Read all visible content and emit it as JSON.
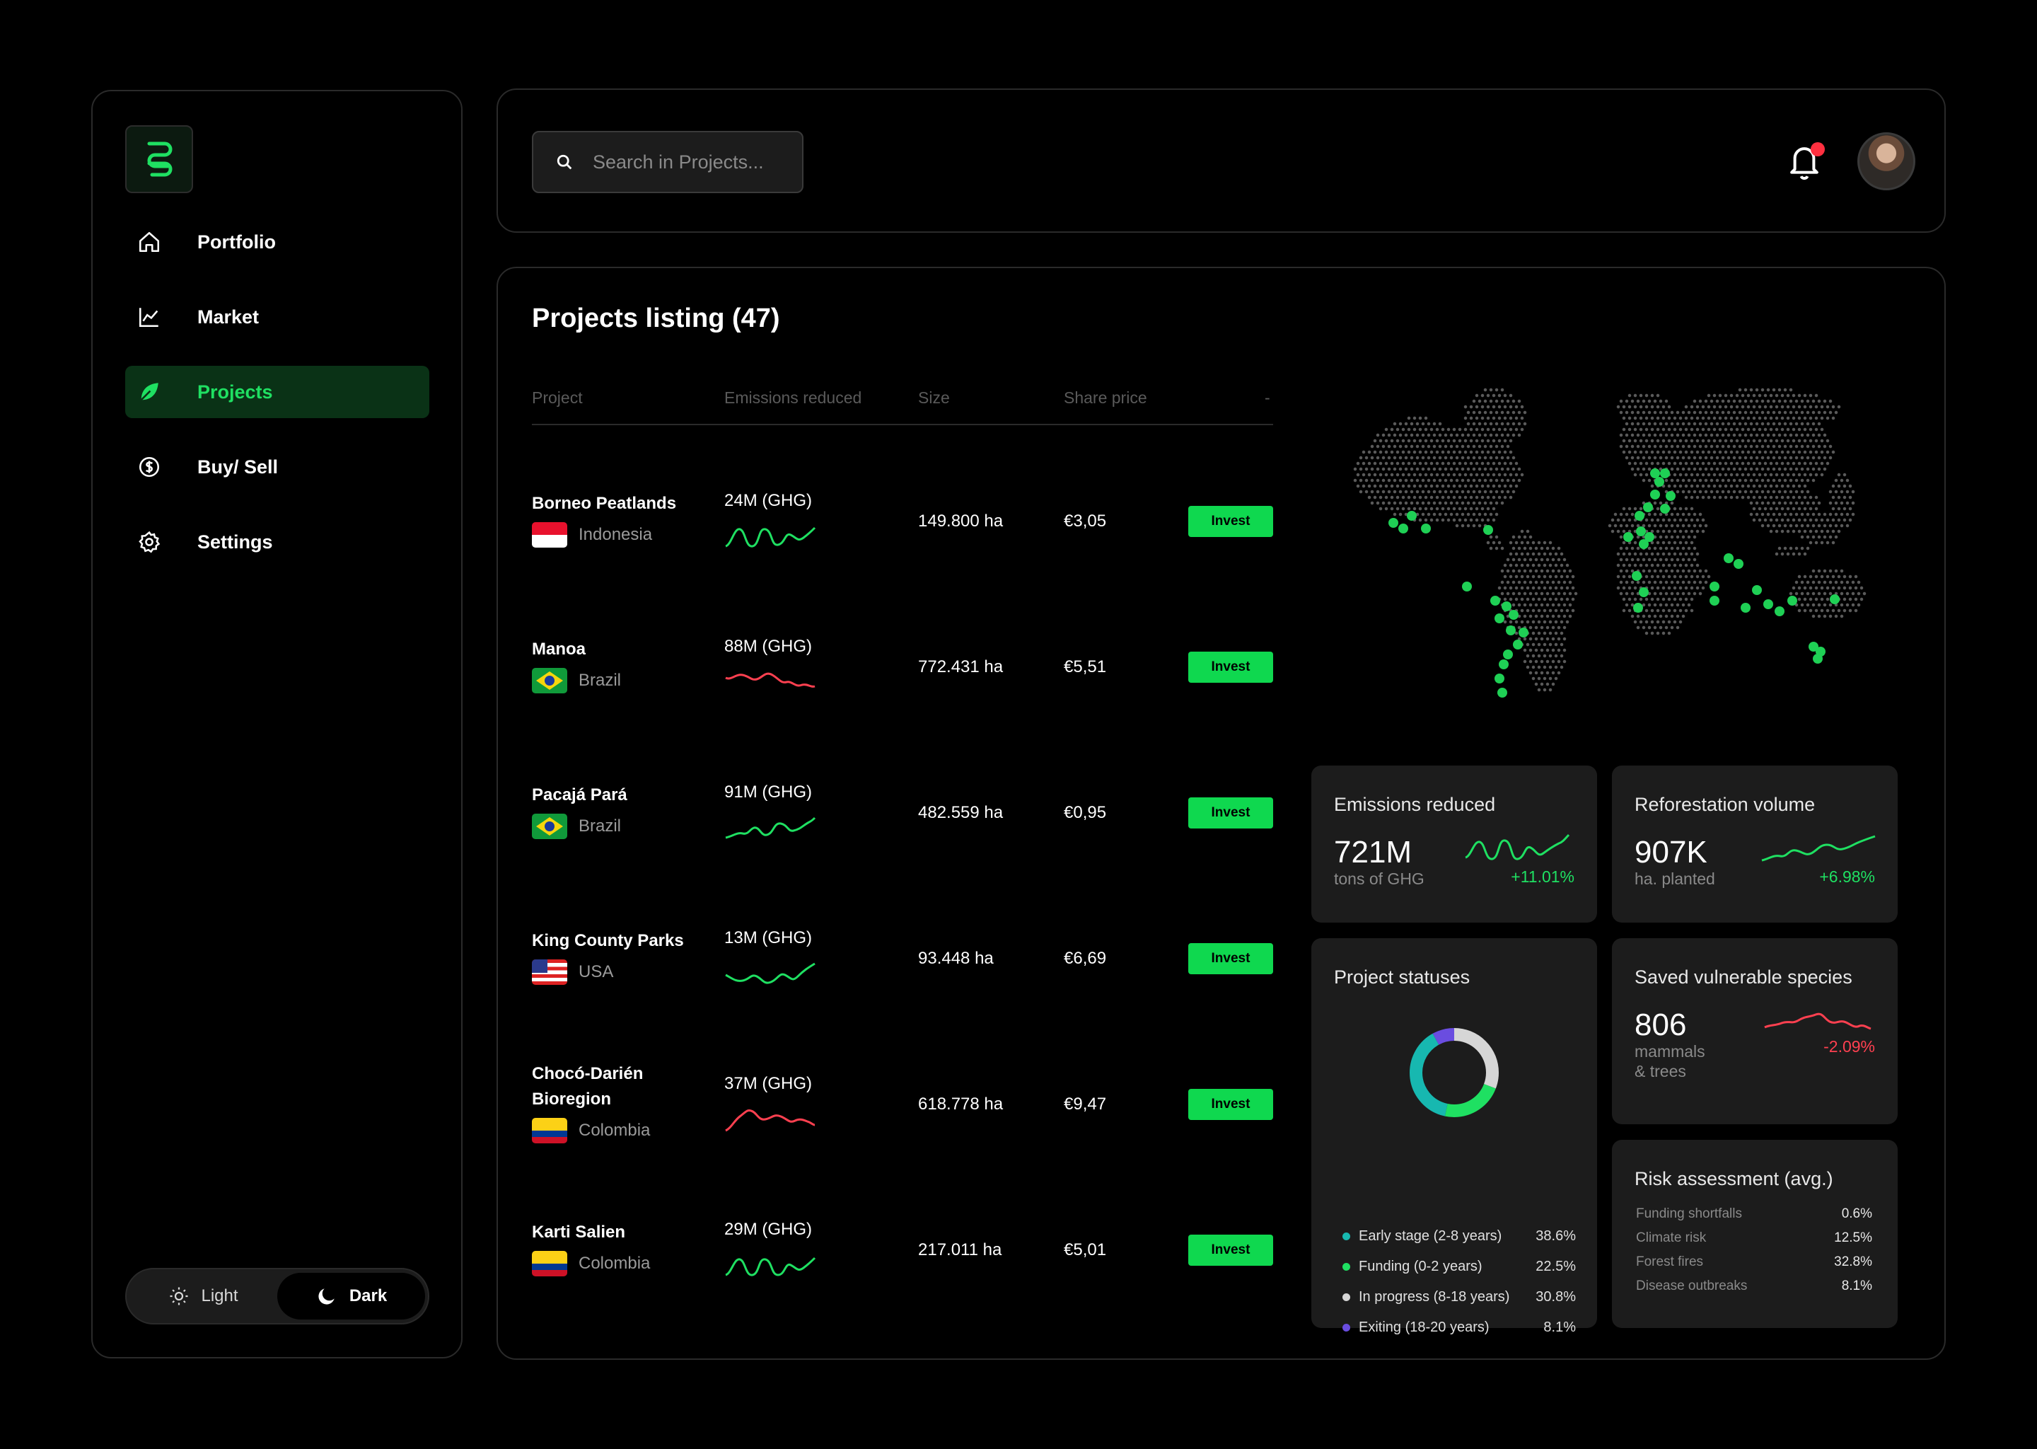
{
  "sidebar": {
    "items": [
      {
        "label": "Portfolio",
        "icon": "home-icon"
      },
      {
        "label": "Market",
        "icon": "chart-icon"
      },
      {
        "label": "Projects",
        "icon": "leaf-icon",
        "active": true
      },
      {
        "label": "Buy/ Sell",
        "icon": "dollar-icon"
      },
      {
        "label": "Settings",
        "icon": "gear-icon"
      }
    ],
    "theme": {
      "light": "Light",
      "dark": "Dark",
      "selected": "Dark"
    }
  },
  "search": {
    "placeholder": "Search in Projects..."
  },
  "main": {
    "title": "Projects listing (47)",
    "columns": [
      "Project",
      "Emissions reduced",
      "Size",
      "Share price",
      "-"
    ],
    "invest_label": "Invest",
    "rows": [
      {
        "name": "Borneo Peatlands",
        "country": "Indonesia",
        "emissions": "24M (GHG)",
        "trend": "up",
        "size": "149.800 ha",
        "price": "€3,05"
      },
      {
        "name": "Manoa",
        "country": "Brazil",
        "emissions": "88M (GHG)",
        "trend": "down",
        "size": "772.431 ha",
        "price": "€5,51"
      },
      {
        "name": "Pacajá Pará",
        "country": "Brazil",
        "emissions": "91M (GHG)",
        "trend": "up",
        "size": "482.559 ha",
        "price": "€0,95"
      },
      {
        "name": "King County Parks",
        "country": "USA",
        "emissions": "13M (GHG)",
        "trend": "up",
        "size": "93.448 ha",
        "price": "€6,69"
      },
      {
        "name": "Chocó-Darién Bioregion",
        "country": "Colombia",
        "emissions": "37M (GHG)",
        "trend": "down",
        "size": "618.778 ha",
        "price": "€9,47"
      },
      {
        "name": "Karti Salien",
        "country": "Colombia",
        "emissions": "29M (GHG)",
        "trend": "up",
        "size": "217.011 ha",
        "price": "€5,01"
      }
    ]
  },
  "stats": {
    "emissions": {
      "title": "Emissions reduced",
      "value": "721M",
      "unit": "tons of GHG",
      "change": "+11.01%"
    },
    "reforestation": {
      "title": "Reforestation volume",
      "value": "907K",
      "unit": "ha. planted",
      "change": "+6.98%"
    },
    "species": {
      "title": "Saved vulnerable species",
      "value": "806",
      "unit1": "mammals",
      "unit2": "& trees",
      "change": "-2.09%"
    },
    "statuses": {
      "title": "Project statuses",
      "items": [
        {
          "label": "Early stage (2-8 years)",
          "value": "38.6%",
          "color": "#17b8b0"
        },
        {
          "label": "Funding (0-2 years)",
          "value": "22.5%",
          "color": "#1fe062"
        },
        {
          "label": "In progress (8-18 years)",
          "value": "30.8%",
          "color": "#d6d6d6"
        },
        {
          "label": "Exiting (18-20 years)",
          "value": "8.1%",
          "color": "#6a4de0"
        }
      ]
    },
    "risk": {
      "title": "Risk assessment (avg.)",
      "items": [
        {
          "label": "Funding shortfalls",
          "value": "0.6%"
        },
        {
          "label": "Climate risk",
          "value": "12.5%"
        },
        {
          "label": "Forest fires",
          "value": "32.8%"
        },
        {
          "label": "Disease outbreaks",
          "value": "8.1%"
        }
      ]
    }
  },
  "colors": {
    "accent": "#1fe062",
    "negative": "#ff4050",
    "card": "#1c1c1c"
  }
}
